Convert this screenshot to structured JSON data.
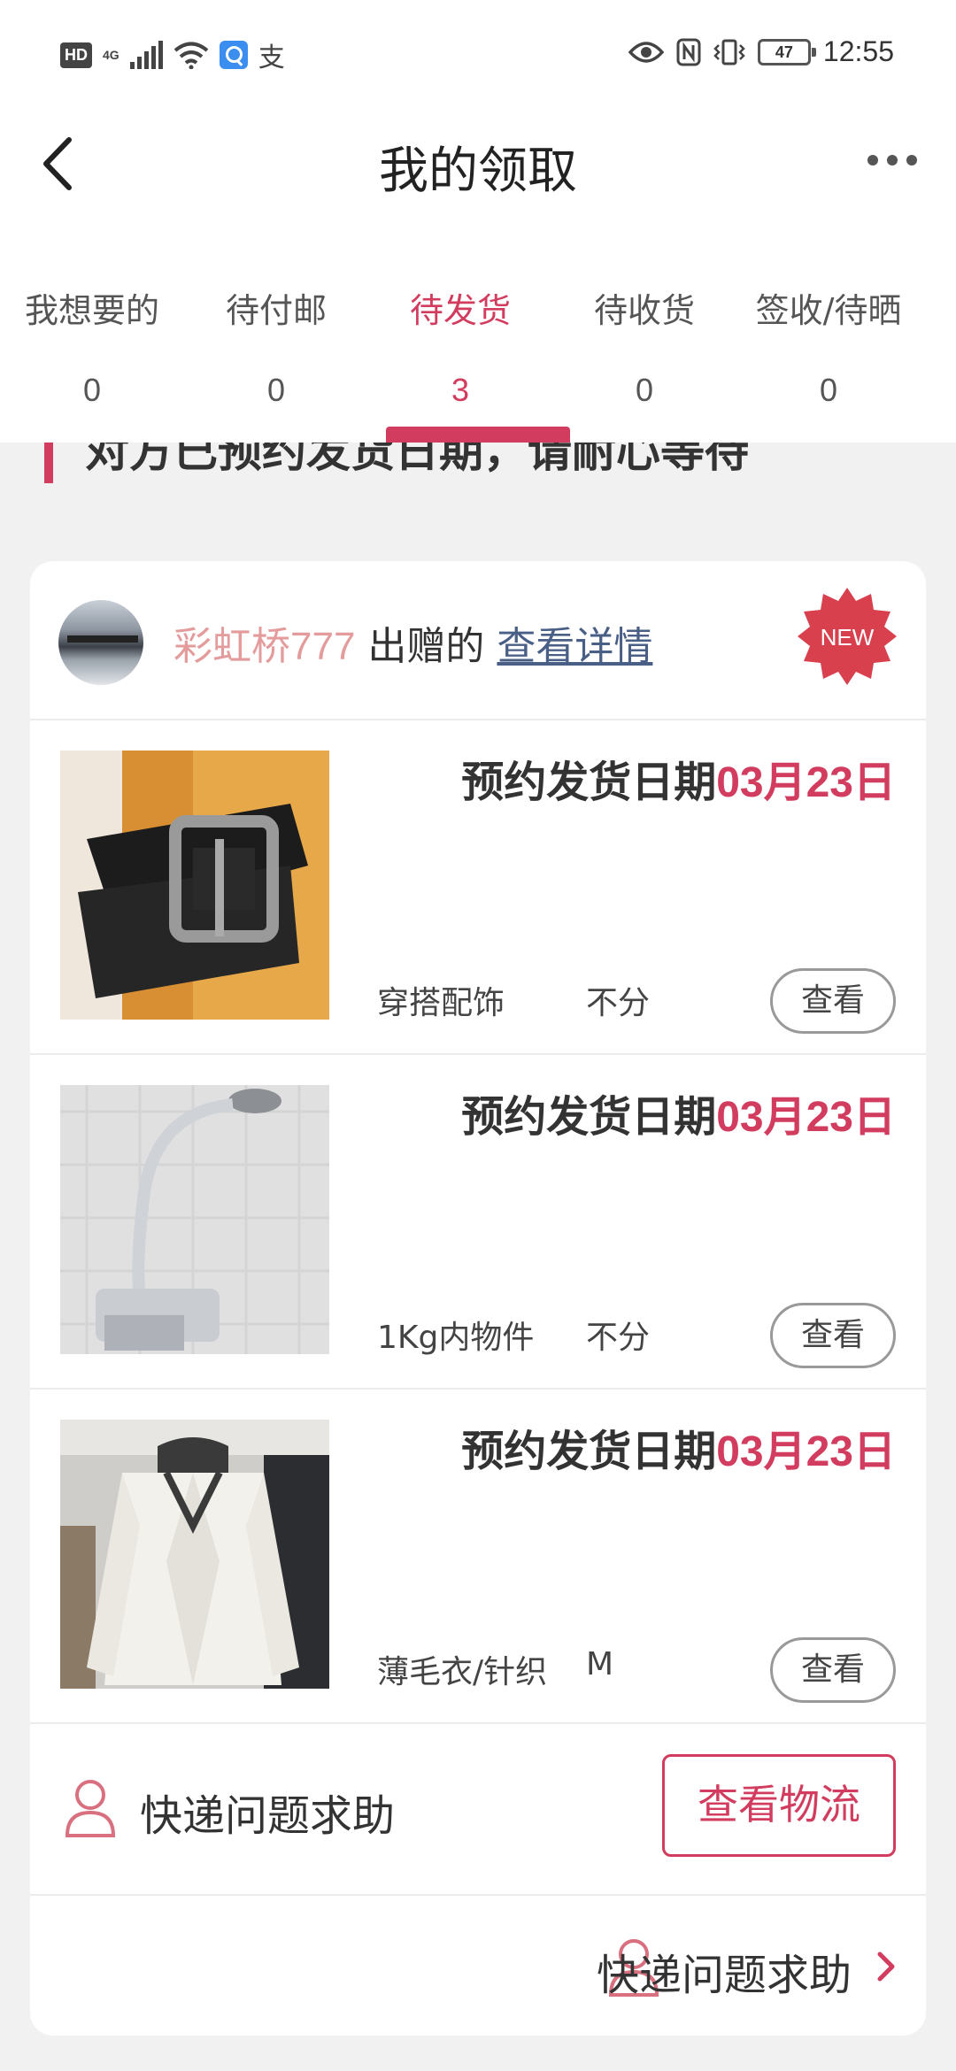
{
  "status_bar": {
    "hd": "HD",
    "network": "4G",
    "alipay_glyph": "支",
    "battery": "47",
    "time": "12:55",
    "icons": [
      "hd-icon",
      "signal-icon",
      "wifi-icon",
      "search-app-icon",
      "alipay-icon",
      "eye-icon",
      "nfc-icon",
      "vibrate-icon",
      "battery-icon"
    ]
  },
  "header": {
    "title": "我的领取"
  },
  "tabs": [
    {
      "label": "我想要的",
      "count": "0"
    },
    {
      "label": "待付邮",
      "count": "0"
    },
    {
      "label": "待发货",
      "count": "3"
    },
    {
      "label": "待收货",
      "count": "0"
    },
    {
      "label": "签收/待晒",
      "count": "0"
    }
  ],
  "active_tab": "待发货",
  "notice": "对方已预约发货日期，请耐心等待",
  "card": {
    "giver_name": "彩虹桥777",
    "giver_suffix": " 出赠的 ",
    "detail_link": "查看详情",
    "badge": "NEW",
    "items": [
      {
        "ship_label": "预约发货日期",
        "ship_date": "03月23日",
        "category": "穿搭配饰",
        "size": "不分",
        "view": "查看"
      },
      {
        "ship_label": "预约发货日期",
        "ship_date": "03月23日",
        "category": "1Kg内物件",
        "size": "不分",
        "view": "查看"
      },
      {
        "ship_label": "预约发货日期",
        "ship_date": "03月23日",
        "category": "薄毛衣/针织",
        "size": "M",
        "view": "查看"
      }
    ],
    "help_label": "快递问题求助",
    "logistics_button": "查看物流",
    "help_label_bottom": "快递问题求助"
  },
  "colors": {
    "accent": "#d23c5e",
    "giver_name": "#e49b9b",
    "link": "#4a5f86"
  }
}
